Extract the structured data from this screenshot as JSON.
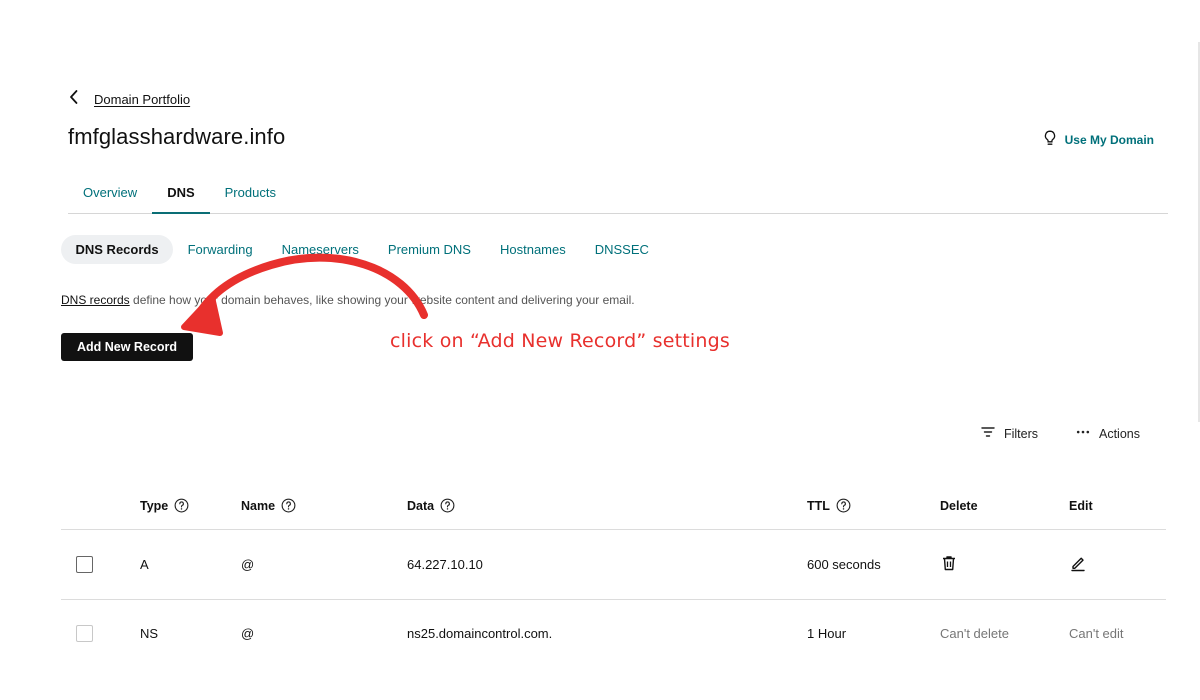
{
  "breadcrumb": {
    "back_icon": "chevron-left-icon",
    "label": "Domain Portfolio"
  },
  "domain": {
    "title": "fmfglasshardware.info"
  },
  "use_domain": {
    "icon": "lightbulb-icon",
    "label": "Use My Domain"
  },
  "tabs": [
    {
      "label": "Overview",
      "active": false
    },
    {
      "label": "DNS",
      "active": true
    },
    {
      "label": "Products",
      "active": false
    }
  ],
  "subtabs": [
    {
      "label": "DNS Records",
      "active": true
    },
    {
      "label": "Forwarding",
      "active": false
    },
    {
      "label": "Nameservers",
      "active": false
    },
    {
      "label": "Premium DNS",
      "active": false
    },
    {
      "label": "Hostnames",
      "active": false
    },
    {
      "label": "DNSSEC",
      "active": false
    }
  ],
  "description": {
    "link": "DNS records",
    "text": " define how your domain behaves, like showing your website content and delivering your email."
  },
  "add_button": {
    "label": "Add New Record"
  },
  "annotation": {
    "text": "click on “Add New Record” settings",
    "color": "#e8302d"
  },
  "toolbar": {
    "filters": {
      "icon": "filter-lines-icon",
      "label": "Filters"
    },
    "actions": {
      "icon": "more-dots-icon",
      "label": "Actions"
    }
  },
  "table": {
    "headers": {
      "type": "Type",
      "name": "Name",
      "data": "Data",
      "ttl": "TTL",
      "delete": "Delete",
      "edit": "Edit"
    },
    "rows": [
      {
        "type": "A",
        "name": "@",
        "data": "64.227.10.10",
        "ttl": "600 seconds",
        "delete": "trash-icon",
        "edit": "pencil-icon"
      },
      {
        "type": "NS",
        "name": "@",
        "data": "ns25.domaincontrol.com.",
        "ttl": "1 Hour",
        "delete": "Can't delete",
        "edit": "Can't edit"
      }
    ]
  },
  "colors": {
    "accent": "#00707a",
    "button": "#111111",
    "annotation": "#e8302d"
  }
}
